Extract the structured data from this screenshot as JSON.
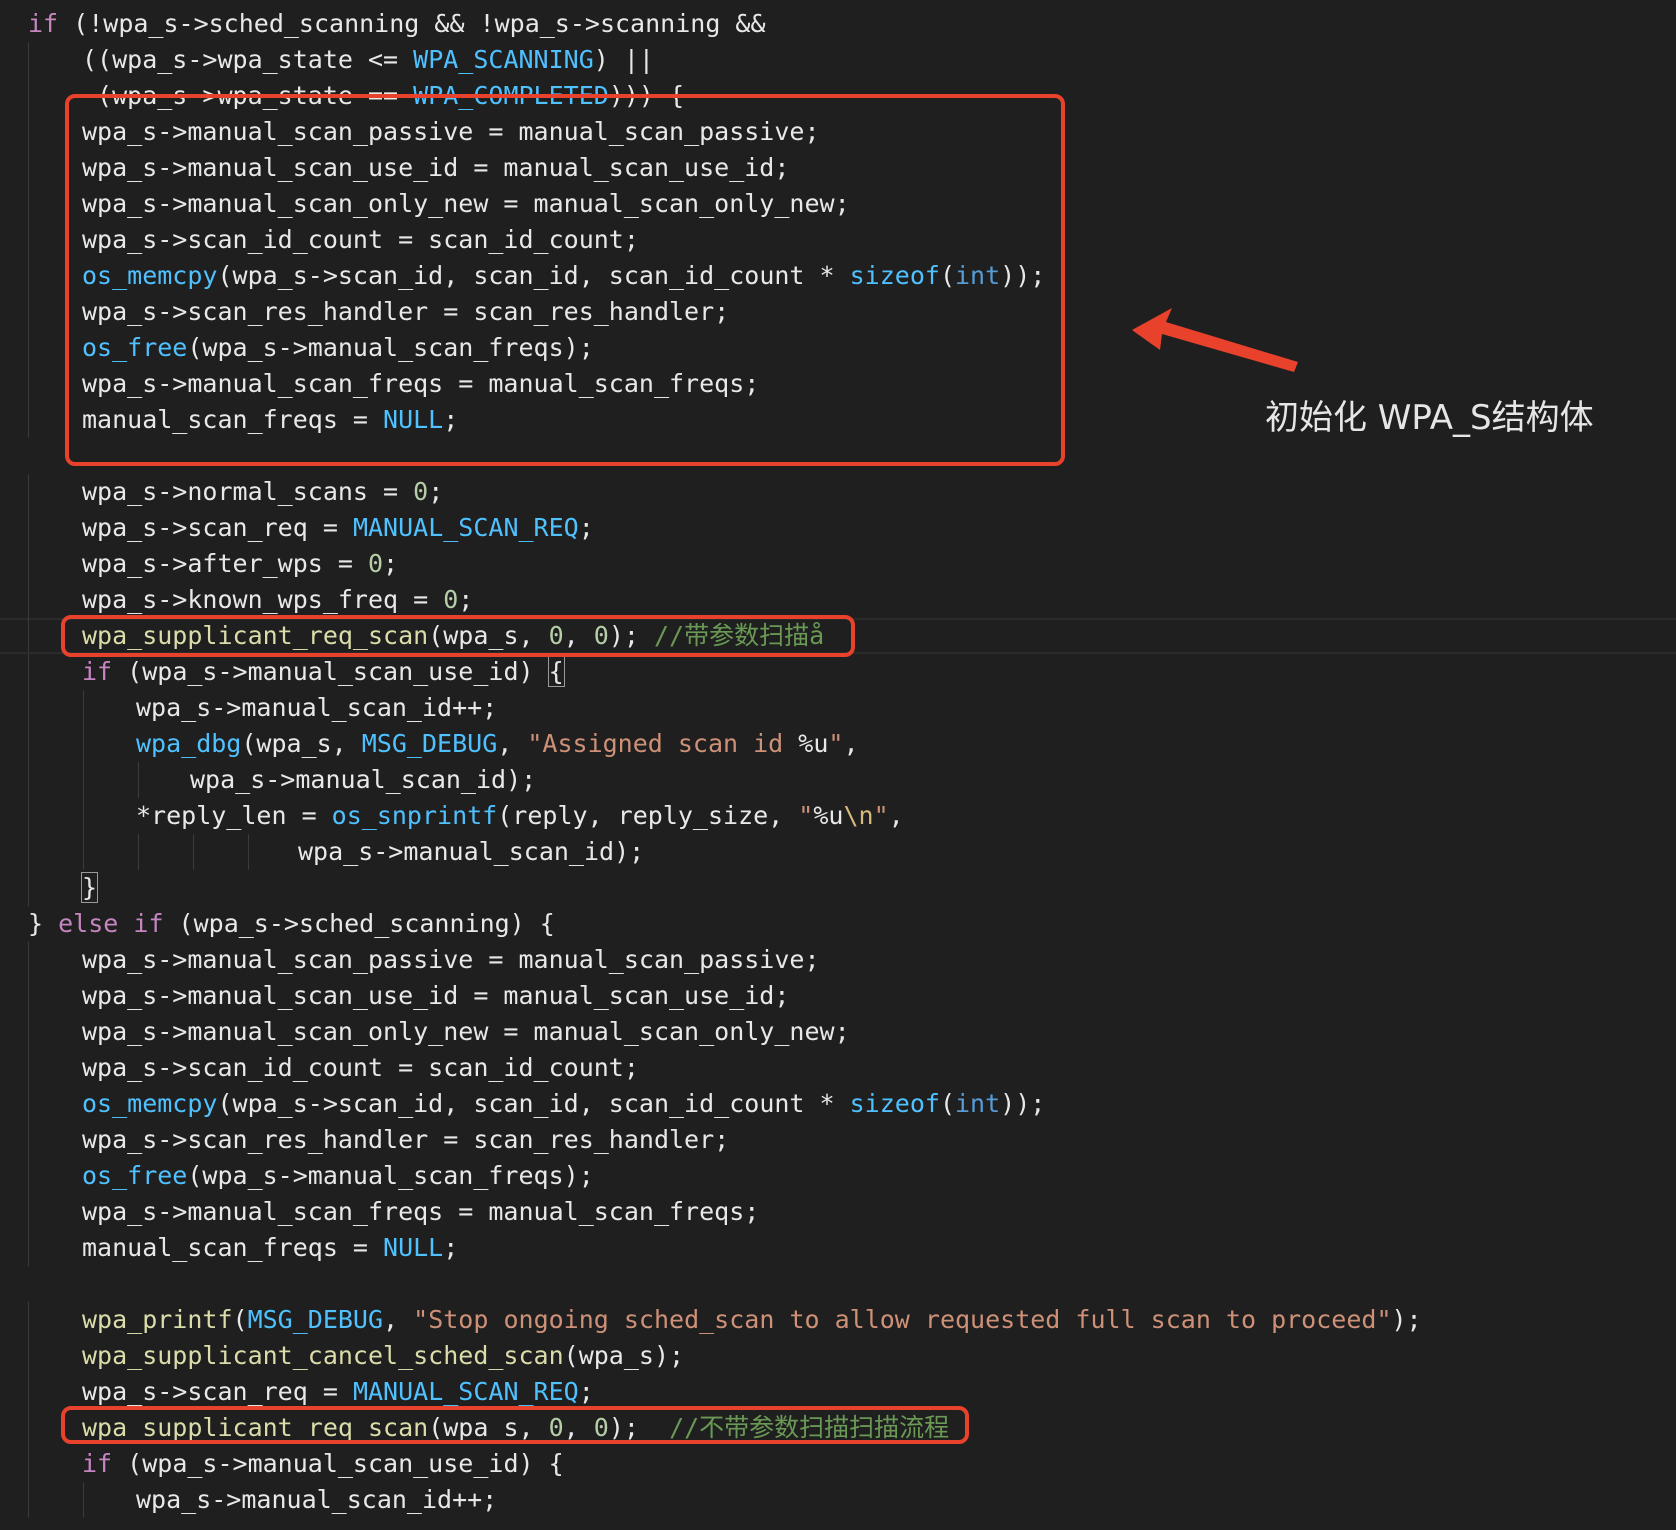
{
  "editor": {
    "theme_background": "#1f1f1f",
    "annotation_color": "#e8412c",
    "lines": [
      {
        "indent": 0,
        "tokens": [
          {
            "t": "if",
            "c": "kw"
          },
          {
            "t": " (!wpa_s->sched_scanning && !wpa_s->scanning &&",
            "c": "var"
          }
        ]
      },
      {
        "indent": 2,
        "tokens": [
          {
            "t": "((wpa_s->wpa_state <= ",
            "c": "var"
          },
          {
            "t": "WPA_SCANNING",
            "c": "const"
          },
          {
            "t": ") ||",
            "c": "var"
          }
        ]
      },
      {
        "indent": 2,
        "tokens": [
          {
            "t": " (wpa_s->wpa_state == ",
            "c": "var"
          },
          {
            "t": "WPA_COMPLETED",
            "c": "const"
          },
          {
            "t": "))) {",
            "c": "var"
          }
        ]
      },
      {
        "indent": 2,
        "tokens": [
          {
            "t": "wpa_s->manual_scan_passive = manual_scan_passive;",
            "c": "var"
          }
        ]
      },
      {
        "indent": 2,
        "tokens": [
          {
            "t": "wpa_s->manual_scan_use_id = manual_scan_use_id;",
            "c": "var"
          }
        ]
      },
      {
        "indent": 2,
        "tokens": [
          {
            "t": "wpa_s->manual_scan_only_new = manual_scan_only_new;",
            "c": "var"
          }
        ]
      },
      {
        "indent": 2,
        "tokens": [
          {
            "t": "wpa_s->scan_id_count = scan_id_count;",
            "c": "var"
          }
        ]
      },
      {
        "indent": 2,
        "tokens": [
          {
            "t": "os_memcpy",
            "c": "lib"
          },
          {
            "t": "(wpa_s->scan_id, scan_id, scan_id_count * ",
            "c": "var"
          },
          {
            "t": "sizeof",
            "c": "lib"
          },
          {
            "t": "(",
            "c": "var"
          },
          {
            "t": "int",
            "c": "type"
          },
          {
            "t": "));",
            "c": "var"
          }
        ]
      },
      {
        "indent": 2,
        "tokens": [
          {
            "t": "wpa_s->scan_res_handler = scan_res_handler;",
            "c": "var"
          }
        ]
      },
      {
        "indent": 2,
        "tokens": [
          {
            "t": "os_free",
            "c": "lib"
          },
          {
            "t": "(wpa_s->manual_scan_freqs);",
            "c": "var"
          }
        ]
      },
      {
        "indent": 2,
        "tokens": [
          {
            "t": "wpa_s->manual_scan_freqs = manual_scan_freqs;",
            "c": "var"
          }
        ]
      },
      {
        "indent": 2,
        "tokens": [
          {
            "t": "manual_scan_freqs = ",
            "c": "var"
          },
          {
            "t": "NULL",
            "c": "const"
          },
          {
            "t": ";",
            "c": "var"
          }
        ]
      },
      {
        "indent": 0,
        "tokens": []
      },
      {
        "indent": 2,
        "tokens": [
          {
            "t": "wpa_s->normal_scans = ",
            "c": "var"
          },
          {
            "t": "0",
            "c": "num"
          },
          {
            "t": ";",
            "c": "var"
          }
        ]
      },
      {
        "indent": 2,
        "tokens": [
          {
            "t": "wpa_s->scan_req = ",
            "c": "var"
          },
          {
            "t": "MANUAL_SCAN_REQ",
            "c": "const"
          },
          {
            "t": ";",
            "c": "var"
          }
        ]
      },
      {
        "indent": 2,
        "tokens": [
          {
            "t": "wpa_s->after_wps = ",
            "c": "var"
          },
          {
            "t": "0",
            "c": "num"
          },
          {
            "t": ";",
            "c": "var"
          }
        ]
      },
      {
        "indent": 2,
        "tokens": [
          {
            "t": "wpa_s->known_wps_freq = ",
            "c": "var"
          },
          {
            "t": "0",
            "c": "num"
          },
          {
            "t": ";",
            "c": "var"
          }
        ]
      },
      {
        "indent": 2,
        "current": true,
        "tokens": [
          {
            "t": "wpa_supplicant_req_scan",
            "c": "fn"
          },
          {
            "t": "(wpa_s, ",
            "c": "var"
          },
          {
            "t": "0",
            "c": "num"
          },
          {
            "t": ", ",
            "c": "var"
          },
          {
            "t": "0",
            "c": "num"
          },
          {
            "t": "); ",
            "c": "var"
          },
          {
            "t": "//带参数扫描å",
            "c": "cmt"
          }
        ]
      },
      {
        "indent": 2,
        "tokens": [
          {
            "t": "if",
            "c": "kw"
          },
          {
            "t": " (wpa_s->manual_scan_use_id) ",
            "c": "var"
          },
          {
            "t": "{",
            "c": "var",
            "hl": true
          }
        ]
      },
      {
        "indent": 4,
        "tokens": [
          {
            "t": "wpa_s->manual_scan_id++;",
            "c": "var"
          }
        ]
      },
      {
        "indent": 4,
        "tokens": [
          {
            "t": "wpa_dbg",
            "c": "lib"
          },
          {
            "t": "(wpa_s, ",
            "c": "var"
          },
          {
            "t": "MSG_DEBUG",
            "c": "const"
          },
          {
            "t": ", ",
            "c": "var"
          },
          {
            "t": "\"Assigned scan id ",
            "c": "str"
          },
          {
            "t": "%u",
            "c": "var"
          },
          {
            "t": "\"",
            "c": "str"
          },
          {
            "t": ",",
            "c": "var"
          }
        ]
      },
      {
        "indent": 6,
        "tokens": [
          {
            "t": "wpa_s->manual_scan_id);",
            "c": "var"
          }
        ]
      },
      {
        "indent": 4,
        "tokens": [
          {
            "t": "*reply_len = ",
            "c": "var"
          },
          {
            "t": "os_snprintf",
            "c": "lib"
          },
          {
            "t": "(reply, reply_size, ",
            "c": "var"
          },
          {
            "t": "\"",
            "c": "str"
          },
          {
            "t": "%u",
            "c": "var"
          },
          {
            "t": "\\n",
            "c": "esc"
          },
          {
            "t": "\"",
            "c": "str"
          },
          {
            "t": ",",
            "c": "var"
          }
        ]
      },
      {
        "indent": 10,
        "tokens": [
          {
            "t": "wpa_s->manual_scan_id);",
            "c": "var"
          }
        ]
      },
      {
        "indent": 2,
        "tokens": [
          {
            "t": "}",
            "c": "var",
            "hl": true
          }
        ]
      },
      {
        "indent": 0,
        "tokens": [
          {
            "t": "} ",
            "c": "var"
          },
          {
            "t": "else",
            "c": "kw"
          },
          {
            "t": " ",
            "c": "var"
          },
          {
            "t": "if",
            "c": "kw"
          },
          {
            "t": " (wpa_s->sched_scanning) {",
            "c": "var"
          }
        ]
      },
      {
        "indent": 2,
        "tokens": [
          {
            "t": "wpa_s->manual_scan_passive = manual_scan_passive;",
            "c": "var"
          }
        ]
      },
      {
        "indent": 2,
        "tokens": [
          {
            "t": "wpa_s->manual_scan_use_id = manual_scan_use_id;",
            "c": "var"
          }
        ]
      },
      {
        "indent": 2,
        "tokens": [
          {
            "t": "wpa_s->manual_scan_only_new = manual_scan_only_new;",
            "c": "var"
          }
        ]
      },
      {
        "indent": 2,
        "tokens": [
          {
            "t": "wpa_s->scan_id_count = scan_id_count;",
            "c": "var"
          }
        ]
      },
      {
        "indent": 2,
        "tokens": [
          {
            "t": "os_memcpy",
            "c": "lib"
          },
          {
            "t": "(wpa_s->scan_id, scan_id, scan_id_count * ",
            "c": "var"
          },
          {
            "t": "sizeof",
            "c": "lib"
          },
          {
            "t": "(",
            "c": "var"
          },
          {
            "t": "int",
            "c": "type"
          },
          {
            "t": "));",
            "c": "var"
          }
        ]
      },
      {
        "indent": 2,
        "tokens": [
          {
            "t": "wpa_s->scan_res_handler = scan_res_handler;",
            "c": "var"
          }
        ]
      },
      {
        "indent": 2,
        "tokens": [
          {
            "t": "os_free",
            "c": "lib"
          },
          {
            "t": "(wpa_s->manual_scan_freqs);",
            "c": "var"
          }
        ]
      },
      {
        "indent": 2,
        "tokens": [
          {
            "t": "wpa_s->manual_scan_freqs = manual_scan_freqs;",
            "c": "var"
          }
        ]
      },
      {
        "indent": 2,
        "tokens": [
          {
            "t": "manual_scan_freqs = ",
            "c": "var"
          },
          {
            "t": "NULL",
            "c": "const"
          },
          {
            "t": ";",
            "c": "var"
          }
        ]
      },
      {
        "indent": 0,
        "tokens": []
      },
      {
        "indent": 2,
        "tokens": [
          {
            "t": "wpa_printf",
            "c": "fn"
          },
          {
            "t": "(",
            "c": "var"
          },
          {
            "t": "MSG_DEBUG",
            "c": "const"
          },
          {
            "t": ", ",
            "c": "var"
          },
          {
            "t": "\"Stop ongoing sched_scan to allow requested full scan to proceed\"",
            "c": "str"
          },
          {
            "t": ");",
            "c": "var"
          }
        ]
      },
      {
        "indent": 2,
        "tokens": [
          {
            "t": "wpa_supplicant_cancel_sched_scan",
            "c": "fn"
          },
          {
            "t": "(wpa_s);",
            "c": "var"
          }
        ]
      },
      {
        "indent": 2,
        "tokens": [
          {
            "t": "wpa_s->scan_req = ",
            "c": "var"
          },
          {
            "t": "MANUAL_SCAN_REQ",
            "c": "const"
          },
          {
            "t": ";",
            "c": "var"
          }
        ]
      },
      {
        "indent": 2,
        "tokens": [
          {
            "t": "wpa_supplicant_req_scan",
            "c": "fn"
          },
          {
            "t": "(wpa_s, ",
            "c": "var"
          },
          {
            "t": "0",
            "c": "num"
          },
          {
            "t": ", ",
            "c": "var"
          },
          {
            "t": "0",
            "c": "num"
          },
          {
            "t": ");  ",
            "c": "var"
          },
          {
            "t": "//不带参数扫描扫描流程",
            "c": "cmt"
          }
        ]
      },
      {
        "indent": 2,
        "tokens": [
          {
            "t": "if",
            "c": "kw"
          },
          {
            "t": " (wpa_s->manual_scan_use_id) {",
            "c": "var"
          }
        ]
      },
      {
        "indent": 4,
        "tokens": [
          {
            "t": "wpa_s->manual_scan_id++;",
            "c": "var"
          }
        ]
      }
    ]
  },
  "annotation": {
    "label": "初始化 WPA_S结构体",
    "arrow": "left-arrow-icon"
  }
}
